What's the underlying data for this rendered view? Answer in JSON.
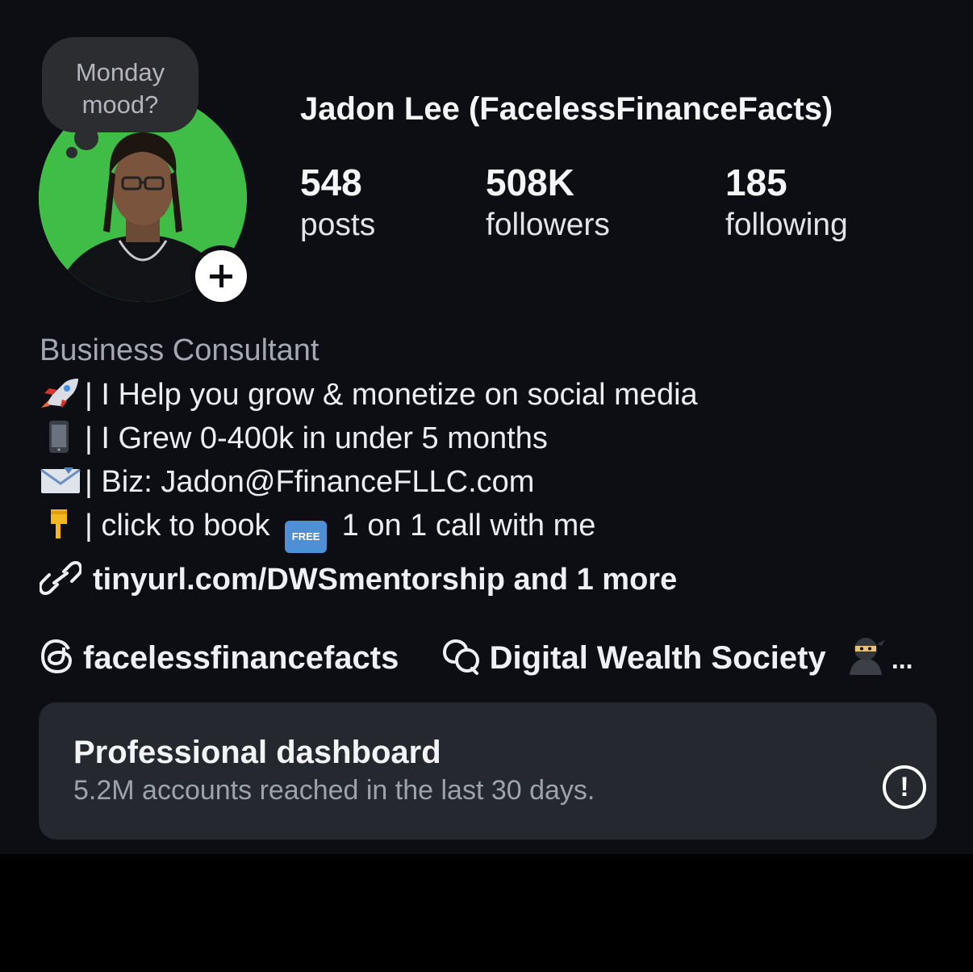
{
  "note": {
    "line1": "Monday",
    "line2": "mood?"
  },
  "profile": {
    "name": "Jadon Lee (FacelessFinanceFacts)",
    "stats": [
      {
        "value": "548",
        "label": "posts"
      },
      {
        "value": "508K",
        "label": "followers"
      },
      {
        "value": "185",
        "label": "following"
      }
    ]
  },
  "bio": {
    "category": "Business Consultant",
    "lines": [
      {
        "icon": "rocket-emoji",
        "text": "| I Help you grow & monetize on social media"
      },
      {
        "icon": "mobile-phone-emoji",
        "text": "| I Grew 0-400k in under 5 months"
      },
      {
        "icon": "envelope-emoji",
        "text": "| Biz: Jadon@FfinanceFLLC.com"
      },
      {
        "icon": "pointing-down-emoji",
        "text": "| click to book",
        "badge": "FREE",
        "after": " 1 on 1 call with me"
      }
    ]
  },
  "links": {
    "icon": "link-icon",
    "text": "tinyurl.com/DWSmentorship and 1 more"
  },
  "social": {
    "threads": {
      "icon": "threads-icon",
      "label": "facelessfinancefacts"
    },
    "channel": {
      "icon": "broadcast-channel-icon",
      "label": "Digital Wealth Society",
      "emoji": "ninja-emoji",
      "more": "..."
    }
  },
  "dashboard": {
    "title": "Professional dashboard",
    "subtitle": "5.2M accounts reached in the last 30 days.",
    "alert_icon": "!"
  },
  "colors": {
    "background": "#0c0e13",
    "avatar_green": "#3fbd46",
    "card": "#25282e",
    "muted_text": "#a4a8ae"
  }
}
